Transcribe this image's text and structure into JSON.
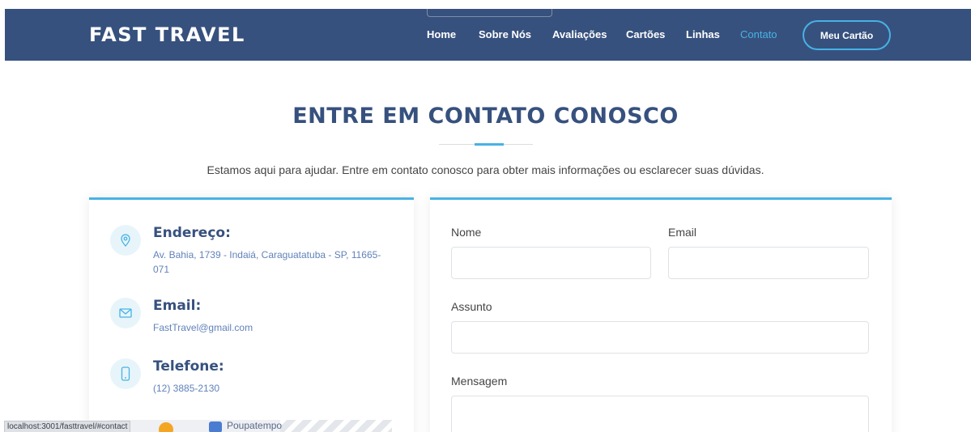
{
  "header": {
    "logo": "FAST TRAVEL",
    "nav": [
      {
        "label": "Home",
        "active": false
      },
      {
        "label": "Sobre Nós",
        "active": false
      },
      {
        "label": "Avaliações",
        "active": false
      },
      {
        "label": "Cartões",
        "active": false
      },
      {
        "label": "Linhas",
        "active": false
      },
      {
        "label": "Contato",
        "active": true
      }
    ],
    "cta_label": "Meu Cartão"
  },
  "section": {
    "title": "ENTRE EM CONTATO CONOSCO",
    "subtitle": "Estamos aqui para ajudar. Entre em contato conosco para obter mais informações ou esclarecer suas dúvidas."
  },
  "info": {
    "address": {
      "title": "Endereço:",
      "text": "Av. Bahia, 1739 - Indaiá, Caraguatatuba - SP, 11665-071",
      "icon": "location-pin-icon"
    },
    "email": {
      "title": "Email:",
      "text": "FastTravel@gmail.com",
      "icon": "envelope-icon"
    },
    "phone": {
      "title": "Telefone:",
      "text": "(12) 3885-2130",
      "icon": "phone-icon"
    },
    "map": {
      "label": "Poupatempo"
    }
  },
  "form": {
    "name_label": "Nome",
    "email_label": "Email",
    "subject_label": "Assunto",
    "message_label": "Mensagem",
    "name_value": "",
    "email_value": "",
    "subject_value": "",
    "message_value": ""
  },
  "status_bar": {
    "url": "localhost:3001/fasttravel/#contact"
  },
  "colors": {
    "header_bg": "#37517e",
    "accent": "#47b2e4",
    "title": "#37517e",
    "info_text": "#6182ba"
  }
}
